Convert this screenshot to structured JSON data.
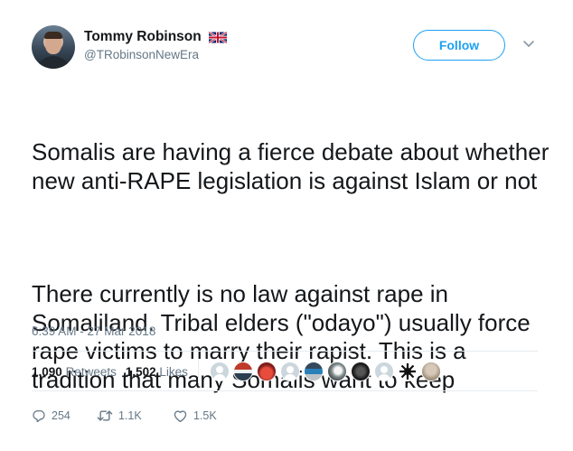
{
  "author": {
    "display_name": "Tommy Robinson",
    "handle": "@TRobinsonNewEra",
    "flag_icon": "uk-flag-icon"
  },
  "follow_button_label": "Follow",
  "tweet": {
    "paragraph_1": "Somalis are having a fierce debate about whether new anti-RAPE legislation is against Islam or not",
    "paragraph_2": "There currently is no law against rape in Somaliland. Tribal elders (\"odayo\") usually force rape victims to marry their rapist. This is a tradition that many Somalis want to keep",
    "timestamp": "6:39 AM - 27 Mar 2018"
  },
  "stats": {
    "retweets_count": "1,090",
    "retweets_label": "Retweets",
    "likes_count": "1,502",
    "likes_label": "Likes"
  },
  "likers": [
    {
      "icon": "default-avatar-icon"
    },
    {
      "icon": "avatar-flag-red"
    },
    {
      "icon": "avatar-red-crowd"
    },
    {
      "icon": "default-avatar-icon"
    },
    {
      "icon": "avatar-badge-blue"
    },
    {
      "icon": "avatar-eagle"
    },
    {
      "icon": "avatar-dark-eagle"
    },
    {
      "icon": "default-avatar-icon"
    },
    {
      "icon": "avatar-black-sun"
    },
    {
      "icon": "avatar-beige"
    }
  ],
  "actions": {
    "replies": "254",
    "retweets": "1.1K",
    "likes": "1.5K"
  },
  "colors": {
    "accent": "#1da1f2",
    "secondary_text": "#657786",
    "divider": "#e6ecf0"
  }
}
